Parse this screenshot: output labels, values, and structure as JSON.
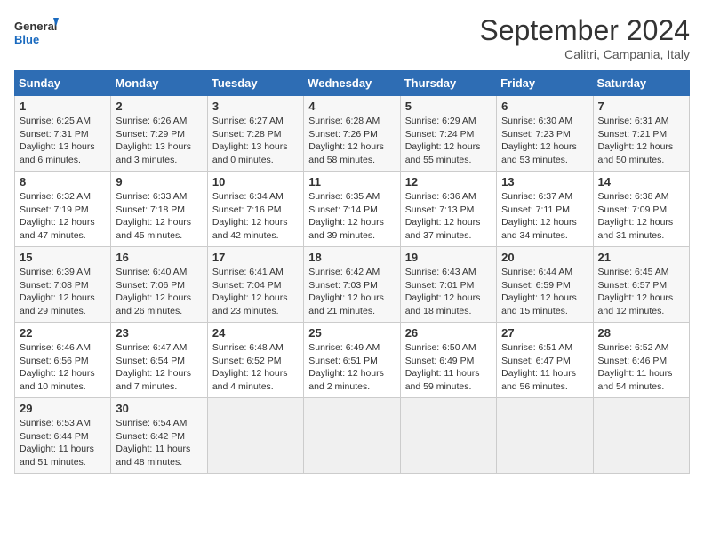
{
  "header": {
    "logo_general": "General",
    "logo_blue": "Blue",
    "month_title": "September 2024",
    "location": "Calitri, Campania, Italy"
  },
  "days_of_week": [
    "Sunday",
    "Monday",
    "Tuesday",
    "Wednesday",
    "Thursday",
    "Friday",
    "Saturday"
  ],
  "weeks": [
    [
      {
        "day": "1",
        "info": "Sunrise: 6:25 AM\nSunset: 7:31 PM\nDaylight: 13 hours and 6 minutes."
      },
      {
        "day": "2",
        "info": "Sunrise: 6:26 AM\nSunset: 7:29 PM\nDaylight: 13 hours and 3 minutes."
      },
      {
        "day": "3",
        "info": "Sunrise: 6:27 AM\nSunset: 7:28 PM\nDaylight: 13 hours and 0 minutes."
      },
      {
        "day": "4",
        "info": "Sunrise: 6:28 AM\nSunset: 7:26 PM\nDaylight: 12 hours and 58 minutes."
      },
      {
        "day": "5",
        "info": "Sunrise: 6:29 AM\nSunset: 7:24 PM\nDaylight: 12 hours and 55 minutes."
      },
      {
        "day": "6",
        "info": "Sunrise: 6:30 AM\nSunset: 7:23 PM\nDaylight: 12 hours and 53 minutes."
      },
      {
        "day": "7",
        "info": "Sunrise: 6:31 AM\nSunset: 7:21 PM\nDaylight: 12 hours and 50 minutes."
      }
    ],
    [
      {
        "day": "8",
        "info": "Sunrise: 6:32 AM\nSunset: 7:19 PM\nDaylight: 12 hours and 47 minutes."
      },
      {
        "day": "9",
        "info": "Sunrise: 6:33 AM\nSunset: 7:18 PM\nDaylight: 12 hours and 45 minutes."
      },
      {
        "day": "10",
        "info": "Sunrise: 6:34 AM\nSunset: 7:16 PM\nDaylight: 12 hours and 42 minutes."
      },
      {
        "day": "11",
        "info": "Sunrise: 6:35 AM\nSunset: 7:14 PM\nDaylight: 12 hours and 39 minutes."
      },
      {
        "day": "12",
        "info": "Sunrise: 6:36 AM\nSunset: 7:13 PM\nDaylight: 12 hours and 37 minutes."
      },
      {
        "day": "13",
        "info": "Sunrise: 6:37 AM\nSunset: 7:11 PM\nDaylight: 12 hours and 34 minutes."
      },
      {
        "day": "14",
        "info": "Sunrise: 6:38 AM\nSunset: 7:09 PM\nDaylight: 12 hours and 31 minutes."
      }
    ],
    [
      {
        "day": "15",
        "info": "Sunrise: 6:39 AM\nSunset: 7:08 PM\nDaylight: 12 hours and 29 minutes."
      },
      {
        "day": "16",
        "info": "Sunrise: 6:40 AM\nSunset: 7:06 PM\nDaylight: 12 hours and 26 minutes."
      },
      {
        "day": "17",
        "info": "Sunrise: 6:41 AM\nSunset: 7:04 PM\nDaylight: 12 hours and 23 minutes."
      },
      {
        "day": "18",
        "info": "Sunrise: 6:42 AM\nSunset: 7:03 PM\nDaylight: 12 hours and 21 minutes."
      },
      {
        "day": "19",
        "info": "Sunrise: 6:43 AM\nSunset: 7:01 PM\nDaylight: 12 hours and 18 minutes."
      },
      {
        "day": "20",
        "info": "Sunrise: 6:44 AM\nSunset: 6:59 PM\nDaylight: 12 hours and 15 minutes."
      },
      {
        "day": "21",
        "info": "Sunrise: 6:45 AM\nSunset: 6:57 PM\nDaylight: 12 hours and 12 minutes."
      }
    ],
    [
      {
        "day": "22",
        "info": "Sunrise: 6:46 AM\nSunset: 6:56 PM\nDaylight: 12 hours and 10 minutes."
      },
      {
        "day": "23",
        "info": "Sunrise: 6:47 AM\nSunset: 6:54 PM\nDaylight: 12 hours and 7 minutes."
      },
      {
        "day": "24",
        "info": "Sunrise: 6:48 AM\nSunset: 6:52 PM\nDaylight: 12 hours and 4 minutes."
      },
      {
        "day": "25",
        "info": "Sunrise: 6:49 AM\nSunset: 6:51 PM\nDaylight: 12 hours and 2 minutes."
      },
      {
        "day": "26",
        "info": "Sunrise: 6:50 AM\nSunset: 6:49 PM\nDaylight: 11 hours and 59 minutes."
      },
      {
        "day": "27",
        "info": "Sunrise: 6:51 AM\nSunset: 6:47 PM\nDaylight: 11 hours and 56 minutes."
      },
      {
        "day": "28",
        "info": "Sunrise: 6:52 AM\nSunset: 6:46 PM\nDaylight: 11 hours and 54 minutes."
      }
    ],
    [
      {
        "day": "29",
        "info": "Sunrise: 6:53 AM\nSunset: 6:44 PM\nDaylight: 11 hours and 51 minutes."
      },
      {
        "day": "30",
        "info": "Sunrise: 6:54 AM\nSunset: 6:42 PM\nDaylight: 11 hours and 48 minutes."
      },
      {
        "day": "",
        "info": ""
      },
      {
        "day": "",
        "info": ""
      },
      {
        "day": "",
        "info": ""
      },
      {
        "day": "",
        "info": ""
      },
      {
        "day": "",
        "info": ""
      }
    ]
  ]
}
